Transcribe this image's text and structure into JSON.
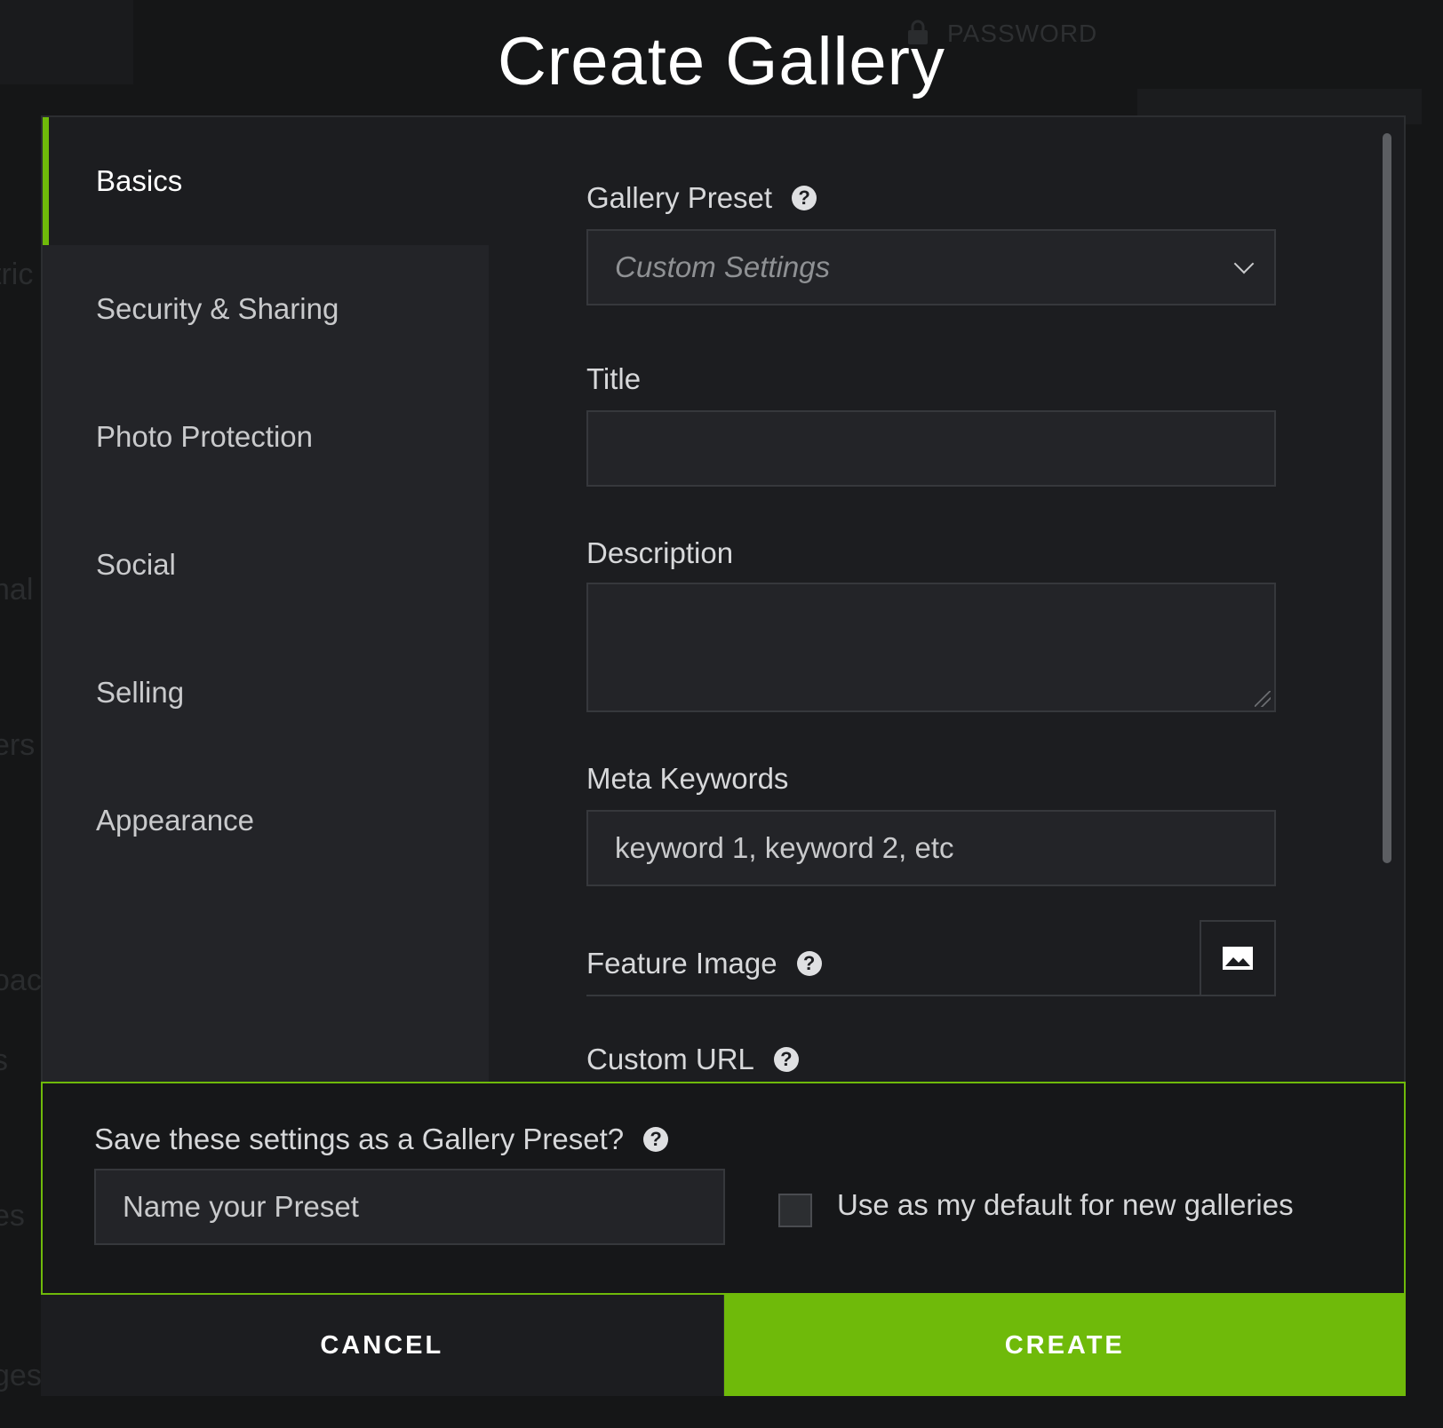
{
  "background": {
    "password_label": "PASSWORD",
    "words": [
      "tric",
      "nal",
      "ers",
      "oac",
      "s",
      "es",
      "ges"
    ]
  },
  "dialog": {
    "title": "Create Gallery"
  },
  "sidebar": {
    "items": [
      {
        "label": "Basics",
        "active": true
      },
      {
        "label": "Security & Sharing",
        "active": false
      },
      {
        "label": "Photo Protection",
        "active": false
      },
      {
        "label": "Social",
        "active": false
      },
      {
        "label": "Selling",
        "active": false
      },
      {
        "label": "Appearance",
        "active": false
      }
    ]
  },
  "form": {
    "gallery_preset": {
      "label": "Gallery Preset",
      "value": "Custom Settings"
    },
    "title": {
      "label": "Title",
      "value": ""
    },
    "description": {
      "label": "Description",
      "value": ""
    },
    "meta_keywords": {
      "label": "Meta Keywords",
      "placeholder": "keyword 1, keyword 2, etc"
    },
    "feature_image": {
      "label": "Feature Image"
    },
    "custom_url": {
      "label": "Custom URL"
    }
  },
  "preset_save": {
    "label": "Save these settings as a Gallery Preset?",
    "input_placeholder": "Name your Preset",
    "default_checkbox_label": "Use as my default for new galleries",
    "default_checked": false
  },
  "footer": {
    "cancel_label": "CANCEL",
    "create_label": "CREATE"
  },
  "colors": {
    "accent": "#6fba0a",
    "background": "#141516",
    "panel": "#1c1d20",
    "sidebar": "#232428"
  },
  "icons": {
    "help": "question-circle-icon",
    "dropdown": "chevron-down-icon",
    "image": "image-icon"
  }
}
